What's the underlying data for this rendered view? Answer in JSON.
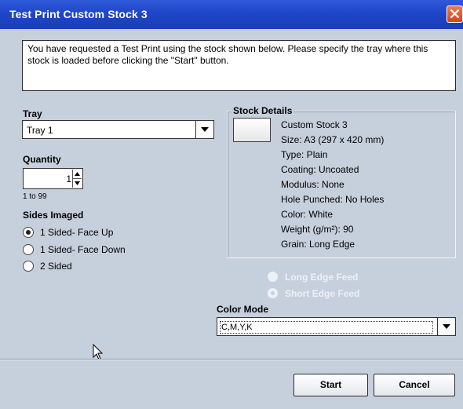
{
  "window": {
    "title": "Test Print Custom Stock 3"
  },
  "message": "You have requested a Test Print using the stock shown below.  Please specify the tray where this stock is loaded before clicking the \"Start\" button.",
  "tray": {
    "label": "Tray",
    "selected": "Tray 1"
  },
  "quantity": {
    "label": "Quantity",
    "value": "1",
    "range_hint": "1 to 99"
  },
  "sides_imaged": {
    "label": "Sides Imaged",
    "options": [
      {
        "label": "1 Sided- Face Up",
        "selected": true
      },
      {
        "label": "1 Sided- Face Down",
        "selected": false
      },
      {
        "label": "2 Sided",
        "selected": false
      }
    ]
  },
  "stock_details": {
    "legend": "Stock Details",
    "lines": [
      "Custom Stock 3",
      "Size: A3 (297 x 420 mm)",
      "Type: Plain",
      "Coating: Uncoated",
      "Modulus: None",
      "Hole Punched: No Holes",
      "Color: White",
      "Weight (g/m²): 90",
      "Grain: Long Edge"
    ]
  },
  "feed": {
    "long_edge": "Long Edge Feed",
    "short_edge": "Short Edge Feed",
    "selected": "short_edge"
  },
  "color_mode": {
    "label": "Color Mode",
    "selected": "C,M,Y,K"
  },
  "buttons": {
    "start": "Start",
    "cancel": "Cancel"
  },
  "colors": {
    "title_bar": "#1f46c9",
    "dialog_bg": "#c6cfdc",
    "close_button": "#d3441e"
  },
  "icons": {
    "close": "close-icon",
    "dropdown": "chevron-down-icon",
    "cursor": "mouse-pointer-icon"
  }
}
